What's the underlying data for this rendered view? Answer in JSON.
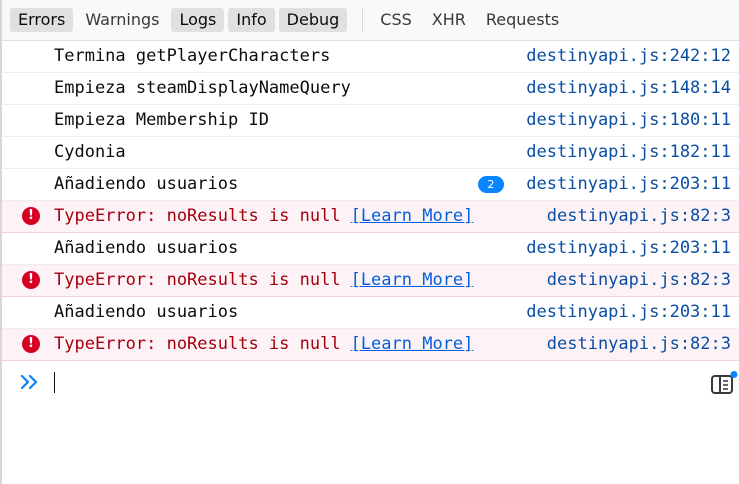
{
  "filters": {
    "errors": "Errors",
    "warnings": "Warnings",
    "logs": "Logs",
    "info": "Info",
    "debug": "Debug",
    "css": "CSS",
    "xhr": "XHR",
    "requests": "Requests"
  },
  "messages": [
    {
      "text": "Termina getPlayerCharacters",
      "source": "destinyapi.js:242:12"
    },
    {
      "text": "Empieza steamDisplayNameQuery",
      "source": "destinyapi.js:148:14"
    },
    {
      "text": "Empieza Membership ID",
      "source": "destinyapi.js:180:11"
    },
    {
      "text": "Cydonia",
      "source": "destinyapi.js:182:11"
    },
    {
      "text": "Añadiendo usuarios",
      "source": "destinyapi.js:203:11",
      "repeat": "2"
    },
    {
      "text": "TypeError: noResults is null",
      "link": "[Learn More]",
      "source": "destinyapi.js:82:3"
    },
    {
      "text": "Añadiendo usuarios",
      "source": "destinyapi.js:203:11"
    },
    {
      "text": "TypeError: noResults is null",
      "link": "[Learn More]",
      "source": "destinyapi.js:82:3"
    },
    {
      "text": "Añadiendo usuarios",
      "source": "destinyapi.js:203:11"
    },
    {
      "text": "TypeError: noResults is null",
      "link": "[Learn More]",
      "source": "destinyapi.js:82:3"
    }
  ],
  "icons": {
    "error": "error-circle-icon",
    "prompt": "chevron-double-right-icon",
    "editor": "split-editor-icon"
  },
  "colors": {
    "error_text": "#a4000f",
    "error_icon": "#d70022",
    "source_link": "#0a4ea3",
    "badge": "#0a84ff"
  }
}
